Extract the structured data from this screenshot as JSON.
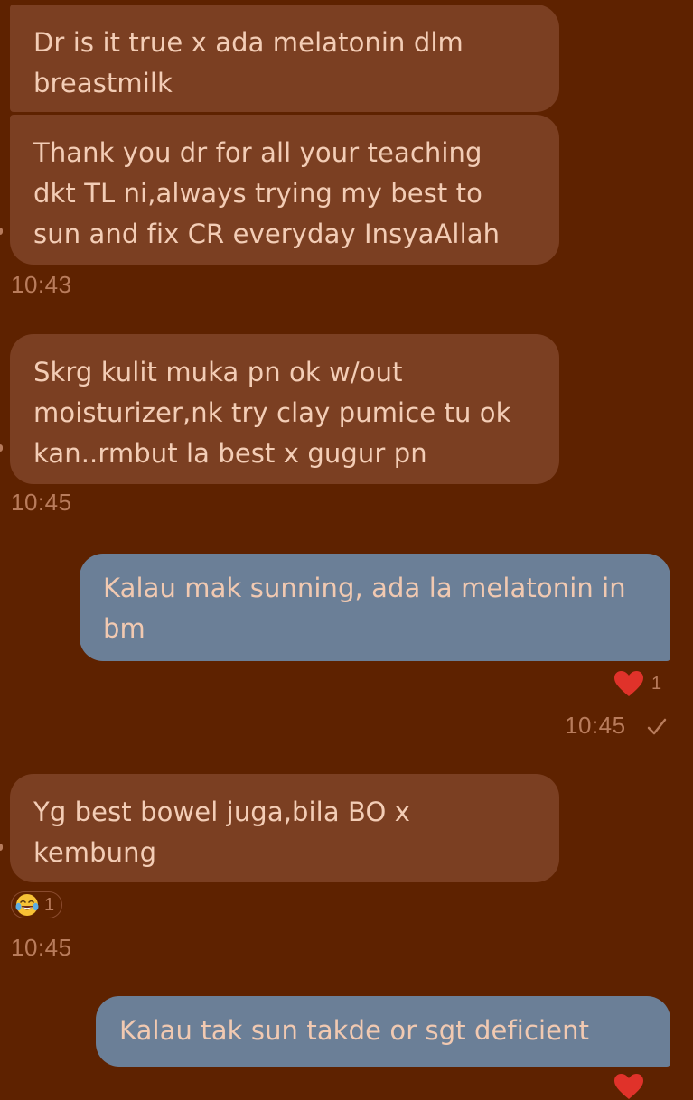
{
  "messages": [
    {
      "direction": "received",
      "text": "Dr is it true  x ada melatonin dlm breastmilk"
    },
    {
      "direction": "received",
      "text": "Thank you dr for all your teaching dkt TL ni,always trying my best to sun and fix CR everyday InsyaAllah",
      "time": "10:43"
    },
    {
      "direction": "received",
      "text": "Skrg kulit muka pn ok w/out moisturizer,nk try clay pumice tu ok kan..rmbut la best x gugur pn",
      "time": "10:45"
    },
    {
      "direction": "sent",
      "text": "Kalau mak sunning, ada la melatonin in bm",
      "reaction": {
        "icon": "heart-icon",
        "count": "1"
      },
      "time": "10:45",
      "status_icon": "check-icon"
    },
    {
      "direction": "received",
      "text": "Yg best bowel juga,bila BO x kembung",
      "reaction": {
        "icon": "tears-of-joy-emoji-icon",
        "count": "1"
      },
      "time": "10:45"
    },
    {
      "direction": "sent",
      "text": "Kalau tak sun takde or sgt deficient",
      "reaction": {
        "icon": "heart-icon"
      }
    }
  ],
  "colors": {
    "background": "#5e2200",
    "received_bubble": "#7b3f22",
    "sent_bubble": "#6b7f97",
    "text": "#f3cdb6",
    "meta_text": "#b97c5c",
    "heart": "#e0322a"
  }
}
